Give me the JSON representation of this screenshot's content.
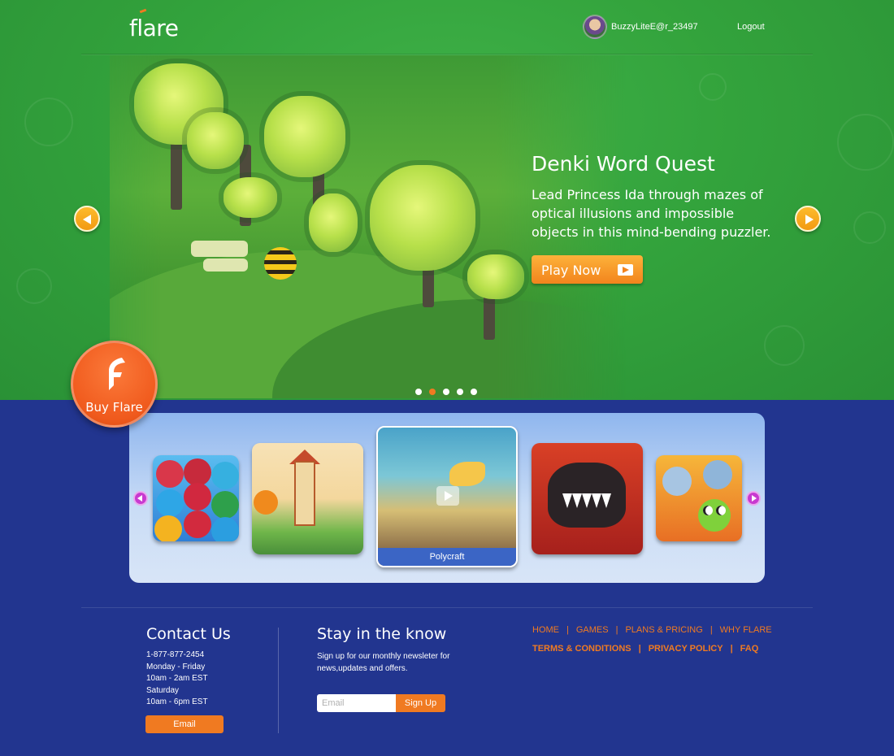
{
  "header": {
    "logo": "flare",
    "username": "BuzzyLiteE@r_23497",
    "logout_label": "Logout"
  },
  "hero": {
    "title": "Denki Word Quest",
    "description": "Lead Princess Ida through mazes of optical illusions and impossible objects in this mind-bending puzzler.",
    "play_label": "Play Now",
    "slide_count": 5,
    "active_slide": 2
  },
  "buy": {
    "label": "Buy Flare"
  },
  "carousel": {
    "selected_caption": "Polycraft"
  },
  "footer": {
    "contact": {
      "heading": "Contact Us",
      "lines": [
        "1-877-877-2454",
        "Monday - Friday",
        "10am - 2am EST",
        "Saturday",
        "10am - 6pm EST"
      ],
      "email_label": "Email"
    },
    "newsletter": {
      "heading": "Stay in the know",
      "text": "Sign up for our monthly newsleter for news,updates and offers.",
      "placeholder": "Email",
      "signup_label": "Sign Up"
    },
    "links_row1": [
      "HOME",
      "GAMES",
      "PLANS & PRICING",
      "WHY FLARE"
    ],
    "links_row2": [
      "TERMS & CONDITIONS",
      "PRIVACY POLICY",
      "FAQ"
    ],
    "separator": "|"
  },
  "colors": {
    "hero_green": "#33a33c",
    "page_blue": "#22358f",
    "accent_orange": "#f07a21",
    "carousel_nav_purple": "#c83ad0"
  },
  "icons": {
    "hero_prev": "chevron-left-icon",
    "hero_next": "chevron-right-icon",
    "play": "play-icon",
    "buy": "flare-logo-icon"
  }
}
